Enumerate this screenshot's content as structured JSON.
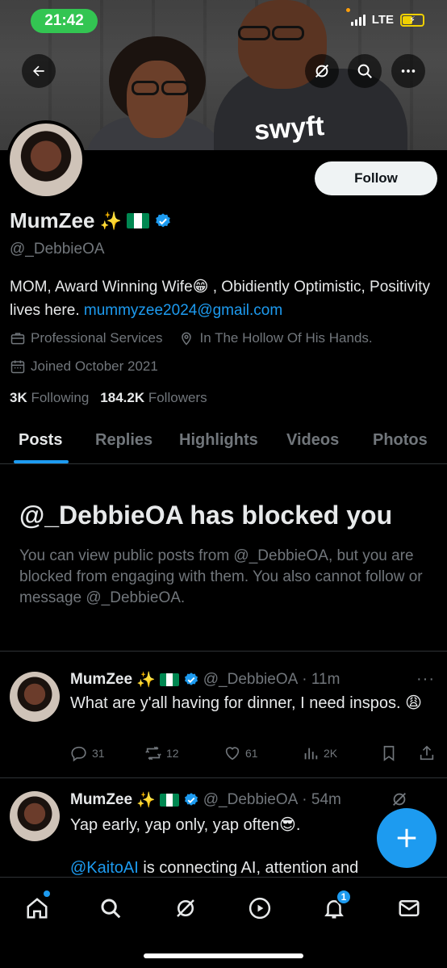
{
  "status_bar": {
    "time": "21:42",
    "network": "LTE"
  },
  "header": {
    "back_icon": "arrow-left-icon",
    "grok_icon": "grok-icon",
    "search_icon": "search-icon",
    "more_icon": "more-icon",
    "banner_logo": "swyft"
  },
  "profile": {
    "display_name": "MumZee",
    "handle": "@_DebbieOA",
    "follow_label": "Follow",
    "bio_text": "MOM, Award Winning Wife😁 , Obidiently Optimistic, Positivity lives here. ",
    "bio_link": "mummyzee2024@gmail.com",
    "category": "Professional Services",
    "location": "In The Hollow Of His Hands.",
    "joined": "Joined October 2021",
    "following_count": "3K",
    "following_label": "Following",
    "followers_count": "184.2K",
    "followers_label": "Followers"
  },
  "tabs": [
    {
      "label": "Posts",
      "active": true
    },
    {
      "label": "Replies"
    },
    {
      "label": "Highlights"
    },
    {
      "label": "Videos"
    },
    {
      "label": "Photos"
    }
  ],
  "blocked": {
    "title": "@_DebbieOA has blocked you",
    "text": "You can view public posts from @_DebbieOA, but you are blocked from engaging with them. You also cannot follow or message @_DebbieOA."
  },
  "posts": [
    {
      "name": "MumZee",
      "handle": "@_DebbieOA",
      "time": "· 11m",
      "text": "What are y'all having for dinner, I need inspos. 😩",
      "replies": "31",
      "reposts": "12",
      "likes": "61",
      "views": "2K"
    },
    {
      "name": "MumZee",
      "handle": "@_DebbieOA",
      "time": "· 54m",
      "text": "Yap early, yap only, yap often😎.",
      "link": "@KaitoAI",
      "text2": " is connecting AI, attention and"
    }
  ],
  "nav": {
    "home": "home-icon",
    "search": "search-icon",
    "grok": "grok-icon",
    "video": "play-icon",
    "notifications": "bell-icon",
    "notification_count": "1",
    "messages": "mail-icon"
  },
  "colors": {
    "accent": "#1d9bf0",
    "muted": "#71767b",
    "text": "#e7e9ea",
    "background": "#000000"
  }
}
